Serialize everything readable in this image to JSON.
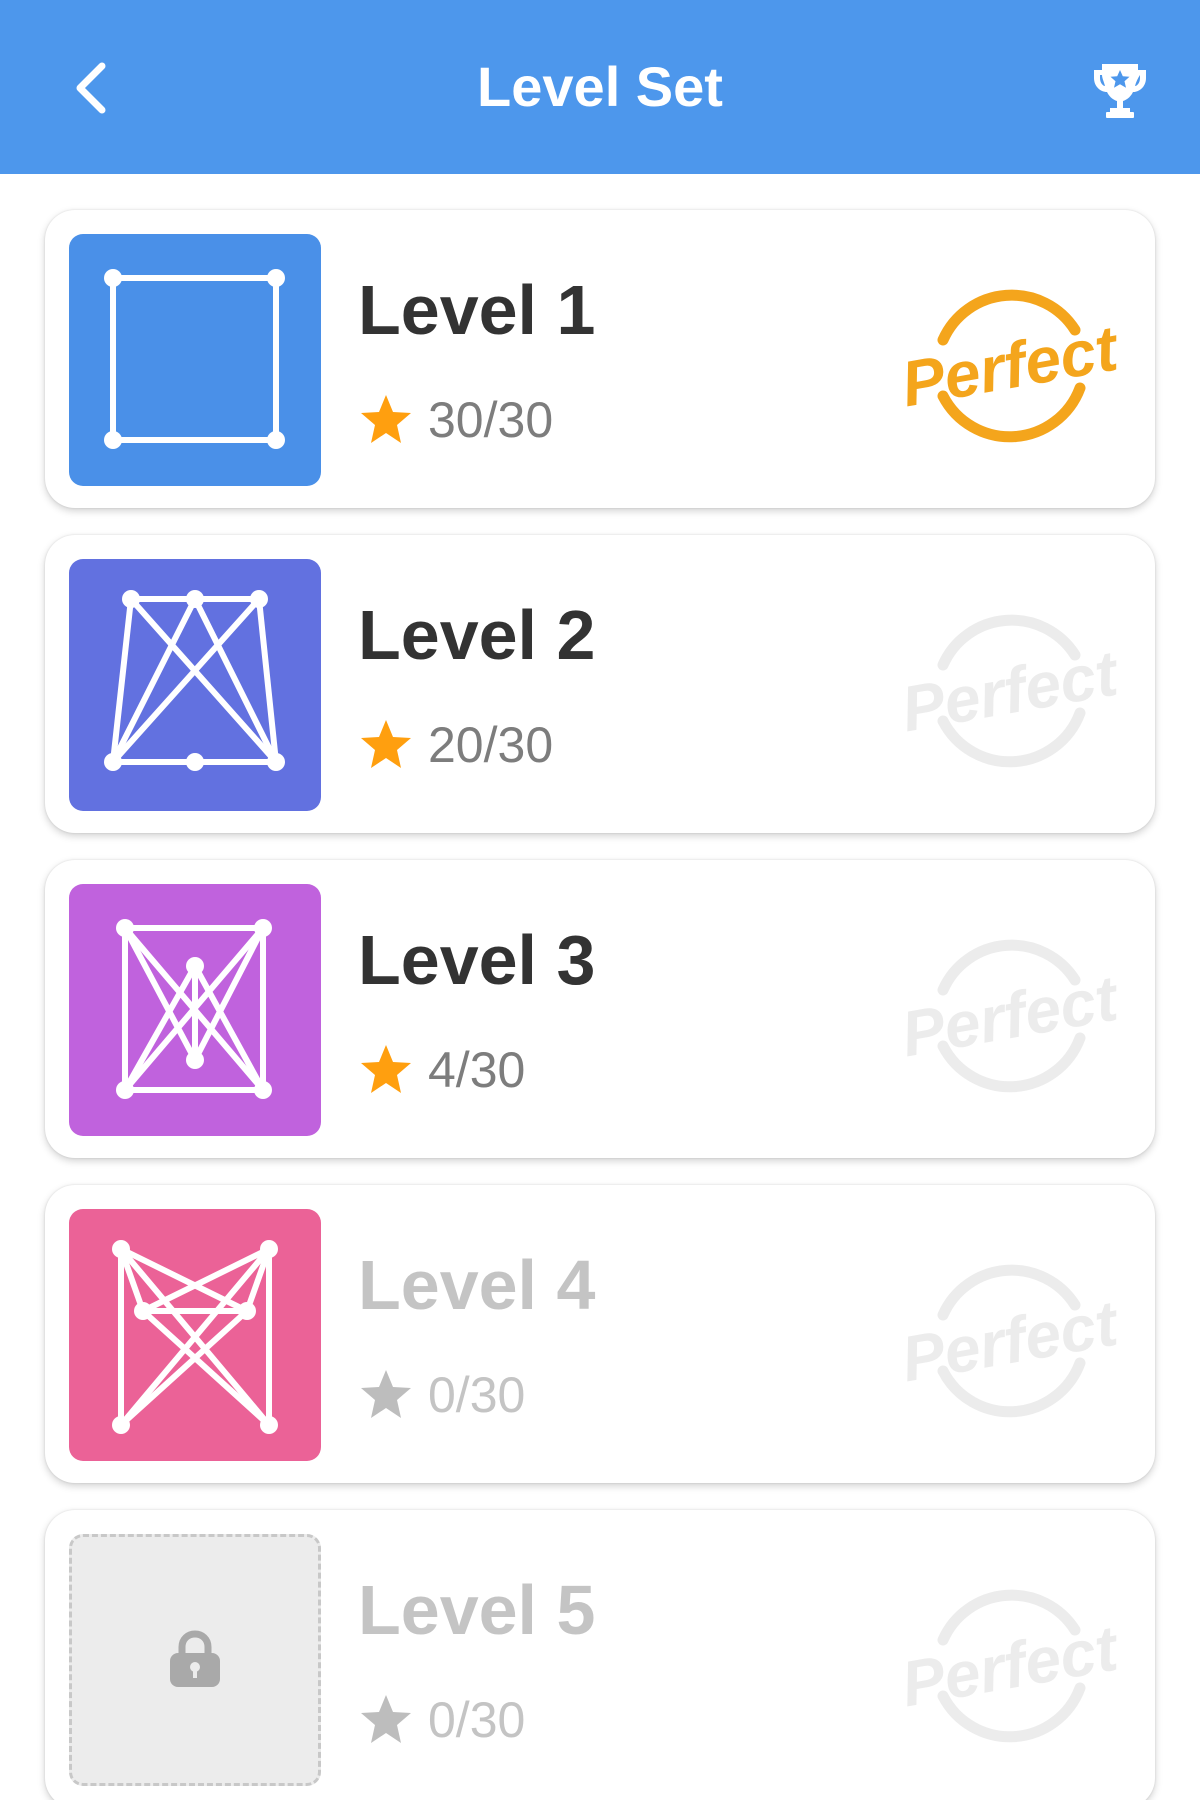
{
  "header": {
    "title": "Level Set",
    "back_icon": "chevron-left-icon",
    "trophy_icon": "trophy-icon",
    "background": "#4d97ec"
  },
  "levels": [
    {
      "name": "Level 1",
      "stars": "30/30",
      "perfect_label": "Perfect",
      "perfect_achieved": true,
      "unlocked": true,
      "color": "#4a90e8",
      "pattern": "square"
    },
    {
      "name": "Level 2",
      "stars": "20/30",
      "perfect_label": "Perfect",
      "perfect_achieved": false,
      "unlocked": true,
      "color": "#6271e0",
      "pattern": "trapezoid-cross"
    },
    {
      "name": "Level 3",
      "stars": "4/30",
      "perfect_label": "Perfect",
      "perfect_achieved": false,
      "unlocked": true,
      "color": "#c062dd",
      "pattern": "box-star"
    },
    {
      "name": "Level 4",
      "stars": "0/30",
      "perfect_label": "Perfect",
      "perfect_achieved": false,
      "unlocked": true,
      "color": "#eb6297",
      "pattern": "bowtie-net"
    },
    {
      "name": "Level 5",
      "stars": "0/30",
      "perfect_label": "Perfect",
      "perfect_achieved": false,
      "unlocked": false,
      "color": "#ececec",
      "pattern": "lock"
    }
  ],
  "colors": {
    "star_active": "#ff9f0f",
    "star_inactive": "#bdbdbd",
    "perfect_active": "#f4a51c",
    "perfect_inactive": "#ececec"
  }
}
